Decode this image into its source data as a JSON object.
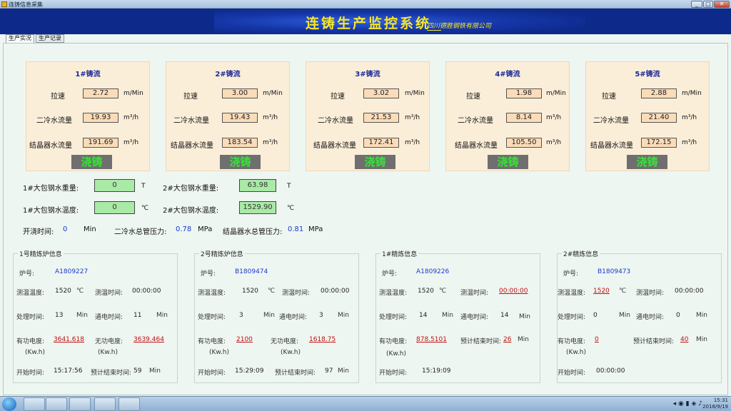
{
  "window": {
    "title": "连铸信息采集"
  },
  "banner": {
    "title": "连铸生产监控系统",
    "company": "四川德胜钢铁有限公司"
  },
  "tabs": [
    {
      "label": "生产实况"
    },
    {
      "label": "生产记录"
    }
  ],
  "strands": [
    {
      "title": "1#铸流",
      "speed": "2.72",
      "flow2": "19.93",
      "flow3": "191.69",
      "status": "浇铸",
      "flow3_label": "结晶器水流量"
    },
    {
      "title": "2#铸流",
      "speed": "3.00",
      "flow2": "19.43",
      "flow3": "183.54",
      "status": "浇铸",
      "flow3_label": "结晶器水流量"
    },
    {
      "title": "3#铸流",
      "speed": "3.02",
      "flow2": "21.53",
      "flow3": "172.41",
      "status": "浇铸",
      "flow3_label": "结晶器水流量"
    },
    {
      "title": "4#铸流",
      "speed": "1.98",
      "flow2": "8.14",
      "flow3": "105.50",
      "status": "浇铸",
      "flow3_label": "结晶器水流量"
    },
    {
      "title": "5#铸流",
      "speed": "2.88",
      "flow2": "21.40",
      "flow3": "172.15",
      "status": "浇铸",
      "flow3_label": "结晶器水流量"
    }
  ],
  "strand_labels": {
    "speed": "拉速",
    "flow2": "二冷水流量",
    "speed_unit": "m/Min",
    "flow_unit": "m³/h"
  },
  "ladle": {
    "w1_label": "1#大包钢水重量:",
    "w1": "0",
    "w_unit": "T",
    "w2_label": "2#大包钢水重量:",
    "w2": "63.98",
    "t1_label": "1#大包钢水温度:",
    "t1": "0",
    "t_unit": "℃",
    "t2_label": "2#大包钢水温度:",
    "t2": "1529.90"
  },
  "info": {
    "pour_label": "开浇时间:",
    "pour": "0",
    "pour_unit": "Min",
    "p2_label": "二冷水总管压力:",
    "p2": "0.78",
    "p_unit": "MPa",
    "p3_label": "结晶器水总管压力:",
    "p3": "0.81"
  },
  "furnaces": [
    {
      "title": "1号精炼炉信息",
      "heat_label": "炉号:",
      "heat": "A1809227",
      "temp": "1520",
      "meas_time": "00:00:00",
      "proc": "13",
      "power_on": "11",
      "active": "3641.618",
      "reactive": "3639.464",
      "start_time": "15:17:56",
      "remain_label": "预计结束时间:",
      "remain": "59"
    },
    {
      "title": "2号精炼炉信息",
      "heat_label": "炉号:",
      "heat": "B1809474",
      "temp": "1520",
      "meas_time": "00:00:00",
      "proc": "3",
      "power_on": "3",
      "active": "2100",
      "reactive": "1618.75",
      "start_time": "15:29:09",
      "remain_label": "预计结束时间:",
      "remain": "97"
    },
    {
      "title": "1#精炼信息",
      "heat_label": "炉号:",
      "heat": "A1809226",
      "temp": "1520",
      "meas_time": "00:00:00",
      "proc": "14",
      "power_on": "14",
      "active": "878.5101",
      "remain_label": "预计结束时间:",
      "remain": "26",
      "start_time": "15:19:09"
    },
    {
      "title": "2#精炼信息",
      "heat_label": "炉号:",
      "heat": "B1809473",
      "temp": "1520",
      "meas_time": "00:00:00",
      "proc": "0",
      "power_on": "0",
      "active": "0",
      "remain_label": "预计结束时间:",
      "remain": "40",
      "start_time": "00:00:00"
    }
  ],
  "furnace_labels": {
    "temp": "测温温度:",
    "temp_unit": "℃",
    "meas_time": "测温时间:",
    "proc": "处理时间:",
    "min": "Min",
    "power_on": "通电时间:",
    "active": "有功电度:",
    "reactive": "无功电度:",
    "kwh": "(Kw.h)",
    "start_time": "开始时间:"
  },
  "taskbar": {
    "time": "15:31",
    "date": "2018/9/19"
  }
}
